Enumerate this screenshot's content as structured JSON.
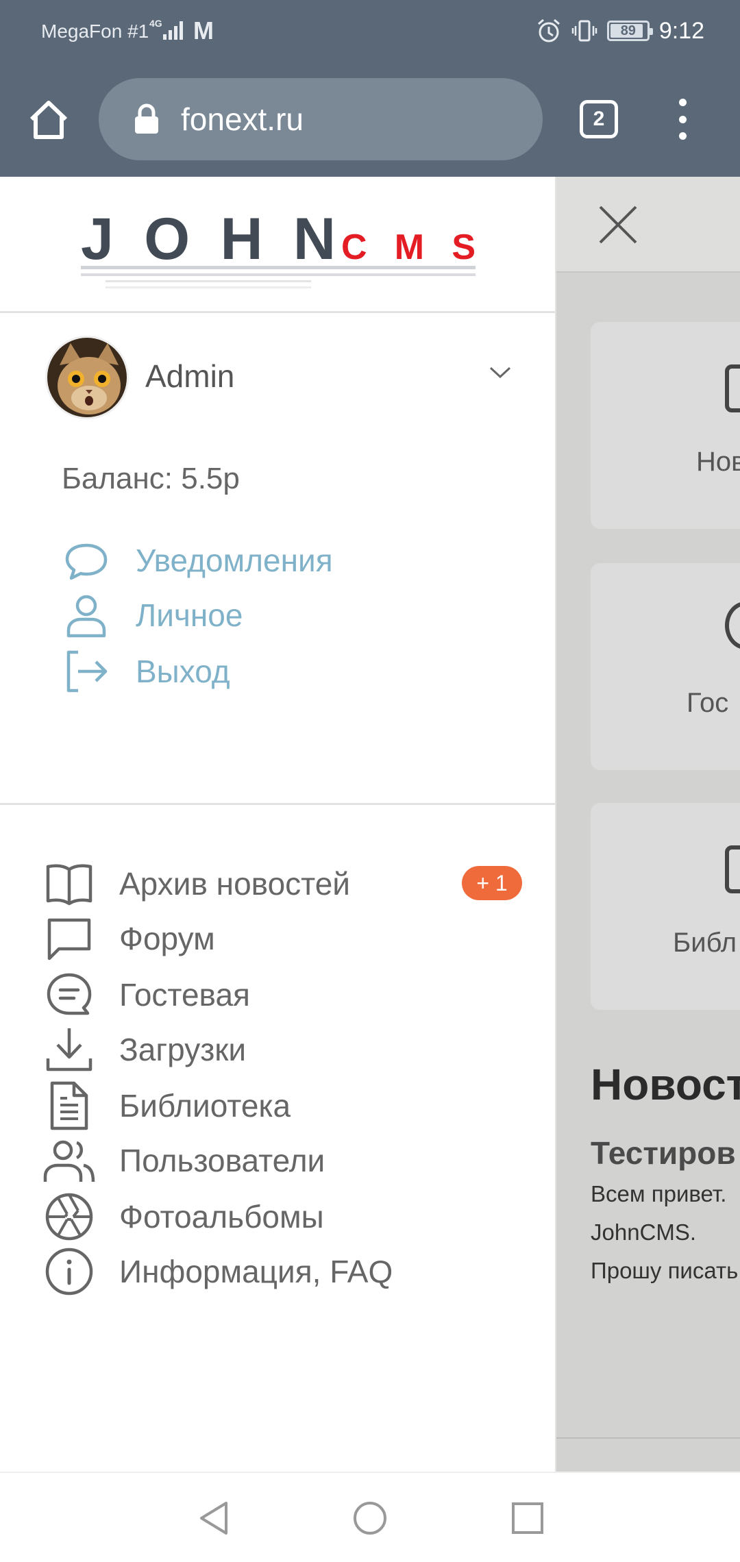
{
  "status_bar": {
    "carrier": "MegaFon #1",
    "network": "4G",
    "battery": "89",
    "time": "9:12",
    "icons": [
      "signal-icon",
      "gmail-icon",
      "alarm-icon",
      "vibrate-icon",
      "battery-icon"
    ]
  },
  "browser": {
    "url": "fonext.ru",
    "tab_count": "2",
    "icons": [
      "home-icon",
      "lock-icon",
      "tabs-icon",
      "more-icon"
    ]
  },
  "drawer": {
    "logo": {
      "main": "JOHN",
      "accent": "CMS",
      "accent_color": "#e41d24",
      "main_color": "#414a55"
    },
    "user": {
      "name": "Admin",
      "balance": "Баланс: 5.5р"
    },
    "user_links": [
      {
        "label": "Уведомления",
        "icon": "chat-bubble-icon"
      },
      {
        "label": "Личное",
        "icon": "user-icon"
      },
      {
        "label": "Выход",
        "icon": "logout-icon"
      }
    ],
    "nav": [
      {
        "label": "Архив новостей",
        "icon": "book-icon",
        "badge": "+ 1"
      },
      {
        "label": "Форум",
        "icon": "message-square-icon"
      },
      {
        "label": "Гостевая",
        "icon": "guestbook-icon"
      },
      {
        "label": "Загрузки",
        "icon": "download-icon"
      },
      {
        "label": "Библиотека",
        "icon": "document-icon"
      },
      {
        "label": "Пользователи",
        "icon": "users-icon"
      },
      {
        "label": "Фотоальбомы",
        "icon": "aperture-icon"
      },
      {
        "label": "Информация, FAQ",
        "icon": "info-icon"
      }
    ],
    "link_color": "#7fb2c9",
    "badge_color": "#f06b3c"
  },
  "background_page": {
    "cards": [
      "Нов",
      "Гос",
      "Библ"
    ],
    "news_title": "Новост",
    "news_subtitle": "Тестиров",
    "news_lines": [
      "Всем привет.",
      "JohnCMS.",
      "Прошу писать"
    ]
  },
  "system_nav": [
    "back-icon",
    "home-circle-icon",
    "recents-icon"
  ]
}
